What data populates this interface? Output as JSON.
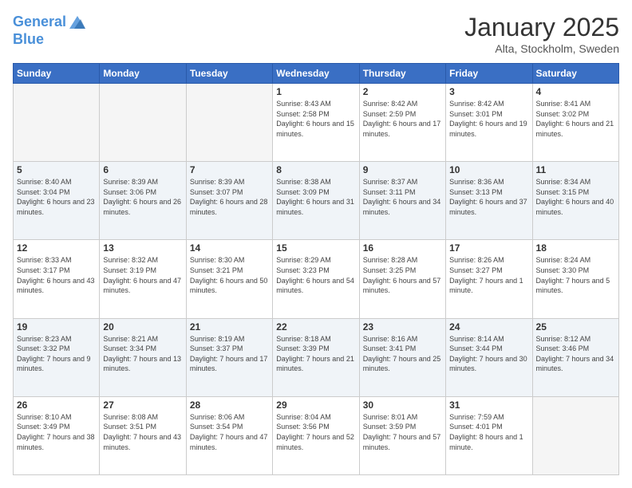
{
  "logo": {
    "line1": "General",
    "line2": "Blue"
  },
  "header": {
    "title": "January 2025",
    "subtitle": "Alta, Stockholm, Sweden"
  },
  "weekdays": [
    "Sunday",
    "Monday",
    "Tuesday",
    "Wednesday",
    "Thursday",
    "Friday",
    "Saturday"
  ],
  "weeks": [
    [
      {
        "day": "",
        "sunrise": "",
        "sunset": "",
        "daylight": "",
        "empty": true
      },
      {
        "day": "",
        "sunrise": "",
        "sunset": "",
        "daylight": "",
        "empty": true
      },
      {
        "day": "",
        "sunrise": "",
        "sunset": "",
        "daylight": "",
        "empty": true
      },
      {
        "day": "1",
        "sunrise": "Sunrise: 8:43 AM",
        "sunset": "Sunset: 2:58 PM",
        "daylight": "Daylight: 6 hours and 15 minutes.",
        "empty": false
      },
      {
        "day": "2",
        "sunrise": "Sunrise: 8:42 AM",
        "sunset": "Sunset: 2:59 PM",
        "daylight": "Daylight: 6 hours and 17 minutes.",
        "empty": false
      },
      {
        "day": "3",
        "sunrise": "Sunrise: 8:42 AM",
        "sunset": "Sunset: 3:01 PM",
        "daylight": "Daylight: 6 hours and 19 minutes.",
        "empty": false
      },
      {
        "day": "4",
        "sunrise": "Sunrise: 8:41 AM",
        "sunset": "Sunset: 3:02 PM",
        "daylight": "Daylight: 6 hours and 21 minutes.",
        "empty": false
      }
    ],
    [
      {
        "day": "5",
        "sunrise": "Sunrise: 8:40 AM",
        "sunset": "Sunset: 3:04 PM",
        "daylight": "Daylight: 6 hours and 23 minutes.",
        "empty": false
      },
      {
        "day": "6",
        "sunrise": "Sunrise: 8:39 AM",
        "sunset": "Sunset: 3:06 PM",
        "daylight": "Daylight: 6 hours and 26 minutes.",
        "empty": false
      },
      {
        "day": "7",
        "sunrise": "Sunrise: 8:39 AM",
        "sunset": "Sunset: 3:07 PM",
        "daylight": "Daylight: 6 hours and 28 minutes.",
        "empty": false
      },
      {
        "day": "8",
        "sunrise": "Sunrise: 8:38 AM",
        "sunset": "Sunset: 3:09 PM",
        "daylight": "Daylight: 6 hours and 31 minutes.",
        "empty": false
      },
      {
        "day": "9",
        "sunrise": "Sunrise: 8:37 AM",
        "sunset": "Sunset: 3:11 PM",
        "daylight": "Daylight: 6 hours and 34 minutes.",
        "empty": false
      },
      {
        "day": "10",
        "sunrise": "Sunrise: 8:36 AM",
        "sunset": "Sunset: 3:13 PM",
        "daylight": "Daylight: 6 hours and 37 minutes.",
        "empty": false
      },
      {
        "day": "11",
        "sunrise": "Sunrise: 8:34 AM",
        "sunset": "Sunset: 3:15 PM",
        "daylight": "Daylight: 6 hours and 40 minutes.",
        "empty": false
      }
    ],
    [
      {
        "day": "12",
        "sunrise": "Sunrise: 8:33 AM",
        "sunset": "Sunset: 3:17 PM",
        "daylight": "Daylight: 6 hours and 43 minutes.",
        "empty": false
      },
      {
        "day": "13",
        "sunrise": "Sunrise: 8:32 AM",
        "sunset": "Sunset: 3:19 PM",
        "daylight": "Daylight: 6 hours and 47 minutes.",
        "empty": false
      },
      {
        "day": "14",
        "sunrise": "Sunrise: 8:30 AM",
        "sunset": "Sunset: 3:21 PM",
        "daylight": "Daylight: 6 hours and 50 minutes.",
        "empty": false
      },
      {
        "day": "15",
        "sunrise": "Sunrise: 8:29 AM",
        "sunset": "Sunset: 3:23 PM",
        "daylight": "Daylight: 6 hours and 54 minutes.",
        "empty": false
      },
      {
        "day": "16",
        "sunrise": "Sunrise: 8:28 AM",
        "sunset": "Sunset: 3:25 PM",
        "daylight": "Daylight: 6 hours and 57 minutes.",
        "empty": false
      },
      {
        "day": "17",
        "sunrise": "Sunrise: 8:26 AM",
        "sunset": "Sunset: 3:27 PM",
        "daylight": "Daylight: 7 hours and 1 minute.",
        "empty": false
      },
      {
        "day": "18",
        "sunrise": "Sunrise: 8:24 AM",
        "sunset": "Sunset: 3:30 PM",
        "daylight": "Daylight: 7 hours and 5 minutes.",
        "empty": false
      }
    ],
    [
      {
        "day": "19",
        "sunrise": "Sunrise: 8:23 AM",
        "sunset": "Sunset: 3:32 PM",
        "daylight": "Daylight: 7 hours and 9 minutes.",
        "empty": false
      },
      {
        "day": "20",
        "sunrise": "Sunrise: 8:21 AM",
        "sunset": "Sunset: 3:34 PM",
        "daylight": "Daylight: 7 hours and 13 minutes.",
        "empty": false
      },
      {
        "day": "21",
        "sunrise": "Sunrise: 8:19 AM",
        "sunset": "Sunset: 3:37 PM",
        "daylight": "Daylight: 7 hours and 17 minutes.",
        "empty": false
      },
      {
        "day": "22",
        "sunrise": "Sunrise: 8:18 AM",
        "sunset": "Sunset: 3:39 PM",
        "daylight": "Daylight: 7 hours and 21 minutes.",
        "empty": false
      },
      {
        "day": "23",
        "sunrise": "Sunrise: 8:16 AM",
        "sunset": "Sunset: 3:41 PM",
        "daylight": "Daylight: 7 hours and 25 minutes.",
        "empty": false
      },
      {
        "day": "24",
        "sunrise": "Sunrise: 8:14 AM",
        "sunset": "Sunset: 3:44 PM",
        "daylight": "Daylight: 7 hours and 30 minutes.",
        "empty": false
      },
      {
        "day": "25",
        "sunrise": "Sunrise: 8:12 AM",
        "sunset": "Sunset: 3:46 PM",
        "daylight": "Daylight: 7 hours and 34 minutes.",
        "empty": false
      }
    ],
    [
      {
        "day": "26",
        "sunrise": "Sunrise: 8:10 AM",
        "sunset": "Sunset: 3:49 PM",
        "daylight": "Daylight: 7 hours and 38 minutes.",
        "empty": false
      },
      {
        "day": "27",
        "sunrise": "Sunrise: 8:08 AM",
        "sunset": "Sunset: 3:51 PM",
        "daylight": "Daylight: 7 hours and 43 minutes.",
        "empty": false
      },
      {
        "day": "28",
        "sunrise": "Sunrise: 8:06 AM",
        "sunset": "Sunset: 3:54 PM",
        "daylight": "Daylight: 7 hours and 47 minutes.",
        "empty": false
      },
      {
        "day": "29",
        "sunrise": "Sunrise: 8:04 AM",
        "sunset": "Sunset: 3:56 PM",
        "daylight": "Daylight: 7 hours and 52 minutes.",
        "empty": false
      },
      {
        "day": "30",
        "sunrise": "Sunrise: 8:01 AM",
        "sunset": "Sunset: 3:59 PM",
        "daylight": "Daylight: 7 hours and 57 minutes.",
        "empty": false
      },
      {
        "day": "31",
        "sunrise": "Sunrise: 7:59 AM",
        "sunset": "Sunset: 4:01 PM",
        "daylight": "Daylight: 8 hours and 1 minute.",
        "empty": false
      },
      {
        "day": "",
        "sunrise": "",
        "sunset": "",
        "daylight": "",
        "empty": true
      }
    ]
  ]
}
